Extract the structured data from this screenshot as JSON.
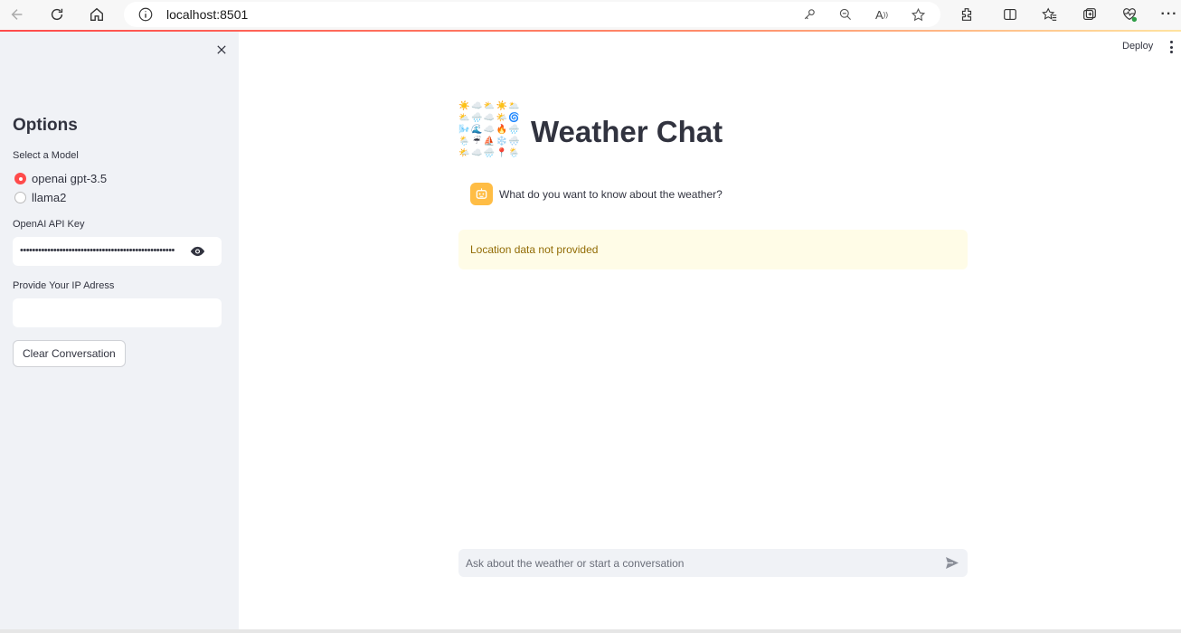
{
  "browser": {
    "url": "localhost:8501",
    "icons": [
      "back-icon",
      "refresh-icon",
      "home-icon",
      "info-icon",
      "key-icon",
      "zoom-icon",
      "read-aloud-icon",
      "favorite-icon",
      "extensions-icon",
      "split-screen-icon",
      "favorites-icon",
      "collections-icon",
      "performance-icon",
      "more-icon"
    ]
  },
  "sidebar": {
    "title": "Options",
    "model_label": "Select a Model",
    "models": [
      {
        "label": "openai gpt-3.5",
        "selected": true
      },
      {
        "label": "llama2",
        "selected": false
      }
    ],
    "api_key_label": "OpenAI API Key",
    "api_key_value": "•••••••••••••••••••••••••••••••••••••••••••••••••••",
    "ip_label": "Provide Your IP Adress",
    "ip_value": "",
    "clear_button": "Clear Conversation"
  },
  "header": {
    "deploy": "Deploy"
  },
  "main": {
    "title": "Weather Chat",
    "assistant_message": "What do you want to know about the weather?",
    "alert": "Location data not provided",
    "chat_placeholder": "Ask about the weather or start a conversation"
  },
  "colors": {
    "accent": "#ff4b4b",
    "sidebar_bg": "#f0f2f6",
    "alert_bg": "#fffce7",
    "alert_text": "#926c05",
    "avatar_bg": "#ffbd45"
  }
}
